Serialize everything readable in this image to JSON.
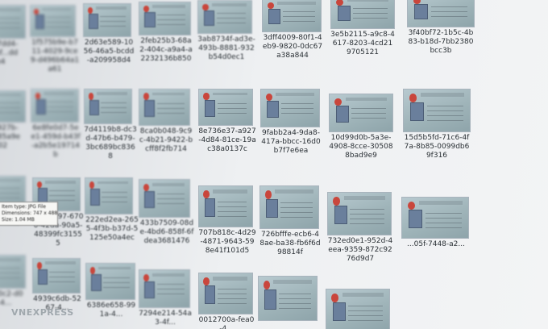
{
  "files": [
    {
      "name": "71f...7dd4-4...5bf...dd1e4"
    },
    {
      "name": "1f575b9e-b711-4029-9ce9-d496b64a1a61"
    },
    {
      "name": "2d63e589-1056-46a5-bcdd-a209958d4"
    },
    {
      "name": "2feb25b3-68a2-404c-a9a4-a2232136b850"
    },
    {
      "name": "3ab8734f-ad3e-493b-8881-932b54d0ec1"
    },
    {
      "name": "3dff4009-80f1-4eb9-9820-0dc67a38a844"
    },
    {
      "name": "3e5b2115-a9c8-4617-8203-4cd219705121"
    },
    {
      "name": "3f40bf72-1b5c-4b83-b18d-7bb2380bcc3b"
    },
    {
      "name": "...9b-927b-4...0485a9e1c02"
    },
    {
      "name": "6e8fe0d7-5ee1-459d-b43f-a2b5e19714b"
    },
    {
      "name": "7d4119b8-dc3d-47b6-b479-3bc689bc8368"
    },
    {
      "name": "8ca0b048-9c9c-4b21-9422-bcff8f2fb714"
    },
    {
      "name": "8e736e37-a927-4d84-81ce-19ac38a0137c"
    },
    {
      "name": "9fabb2a4-9da8-417a-bbcc-16d0b7f7e6ea"
    },
    {
      "name": "10d99d0b-5a3e-4908-8cce-305088bad9e9"
    },
    {
      "name": "15d5b5fd-71c6-4f7a-8b85-0099db69f316"
    },
    {
      "name": "...6fb9-4...078b61...6a2"
    },
    {
      "name": "79c92f97-6700-42da-90a5-48399fc31555"
    },
    {
      "name": "222ed2ea-2655-4f3b-b37d-5125e50a4ec"
    },
    {
      "name": "433b7509-08de-4bd6-858f-6fdea3681476"
    },
    {
      "name": "707b818c-4d29-4871-9643-598e41f101d5"
    },
    {
      "name": "726bfffe-ecb6-48ae-ba38-fb6f6d98814f"
    },
    {
      "name": "732ed0e1-952d-4eea-9359-872c9276d9d7"
    },
    {
      "name": "...05f-7448-a2..."
    },
    {
      "name": "4382f0c2-d0ab-4..."
    },
    {
      "name": "4939c6db-5267-4..."
    },
    {
      "name": "6386e658-991a-4..."
    },
    {
      "name": "7294e214-54a3-4f..."
    },
    {
      "name": "0012700a-fea0-4..."
    },
    {
      "name": ""
    },
    {
      "name": ""
    }
  ],
  "tooltip": {
    "type": "Item type: JPG File",
    "dimensions": "Dimensions: 747 x 488",
    "size": "Size: 1.04 MB"
  },
  "watermark": {
    "text_a": "VN",
    "text_b": "EXPRESS"
  }
}
